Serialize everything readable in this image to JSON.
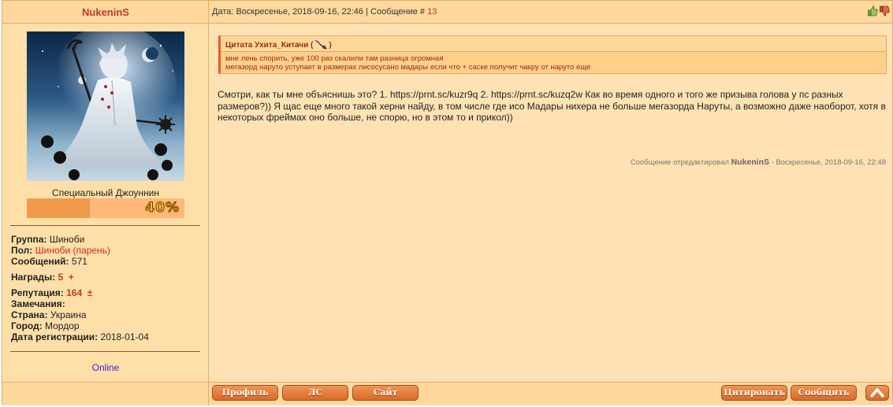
{
  "author": {
    "nickname": "NukeninS",
    "rank_title": "Специальный Джоуннин",
    "rank_progress_label": "40%",
    "rank_progress": 0.4,
    "group_label": "Группа:",
    "group_value": "Шиноби",
    "gender_label": "Пол:",
    "gender_value": "Шиноби (парень)",
    "messages_label": "Сообщений:",
    "messages_value": "571",
    "awards_label": "Награды:",
    "awards_value": "5",
    "awards_plus": "+",
    "reputation_label": "Репутация:",
    "reputation_value": "164",
    "reputation_pm": "±",
    "warnings_label": "Замечания:",
    "country_label": "Страна:",
    "country_value": "Украина",
    "city_label": "Город:",
    "city_value": "Мордор",
    "registered_label": "Дата регистрации:",
    "registered_value": "2018-01-04",
    "status": "Online"
  },
  "post": {
    "meta_prefix": "Дата: Воскресенье, 2018-09-16, 22:46 | Сообщение #",
    "number": "13",
    "quote_header": "Цитата Ухита_Китачи (",
    "quote_header_end": ")",
    "quote_line1": "мне лень спорить, уже 100 раз скалили там разница огромная",
    "quote_line2": "мегазорд наруто уступает в размерах лисосусано мадары если что + саске получит чакру от наруто еще",
    "text": "Смотри, как ты мне объяснишь это? 1. https://prnt.sc/kuzr9q 2. https://prnt.sc/kuzq2w Как во время одного и того же призыва голова у пс разных размеров?)) Я щас еще много такой херни найду, в том числе где исо Мадары нихера не больше мегазорда Наруты, а возможно даже наоборот, хотя в некоторых фреймах оно больше, не спорю, но в этом то и прикол))",
    "edited_prefix": "Сообщение отредактировал",
    "edited_by": "NukeninS",
    "edited_suffix": "- Воскресенье, 2018-09-16, 22:48"
  },
  "buttons": {
    "profile": "Профиль",
    "pm": "ЛС",
    "site": "Сайт",
    "quote": "Цитировать",
    "report": "Сообщить"
  },
  "icons": {
    "vote_up": "thumbs-up-icon",
    "vote_down": "thumbs-down-icon",
    "quote_source": "weapon-icon",
    "scroll_top": "arrow-up-icon"
  },
  "colors": {
    "accent": "#e67a34",
    "nickname": "#c0392b",
    "online": "#3b22d6"
  }
}
